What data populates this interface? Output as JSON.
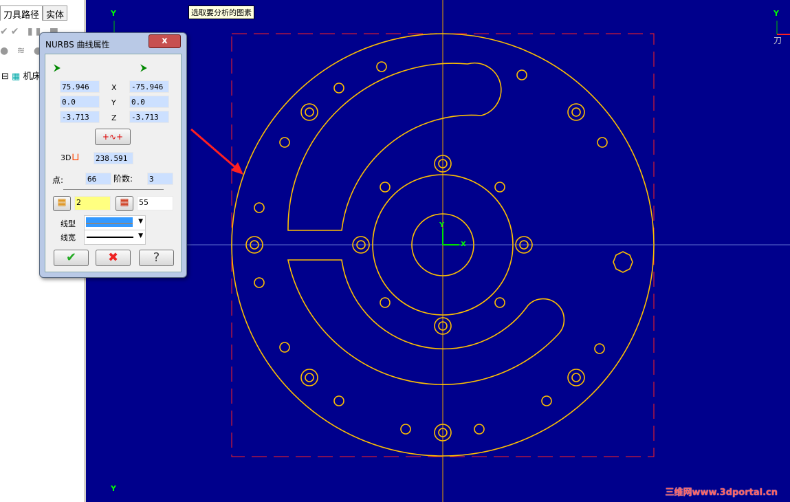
{
  "left_panel": {
    "tabs": [
      "刀具路径",
      "实体"
    ],
    "tree": [
      {
        "label": "机床"
      }
    ]
  },
  "hint": "选取要分析的图素",
  "axis": {
    "y_label": "Y",
    "x_label": "X",
    "tool_label": "刀"
  },
  "dialog": {
    "title": "NURBS 曲线属性",
    "close": "x",
    "start": {
      "x": "75.946",
      "y": "0.0",
      "z": "-3.713"
    },
    "end": {
      "x": "-75.946",
      "y": "0.0",
      "z": "-3.713"
    },
    "axis_labels": [
      "X",
      "Y",
      "Z"
    ],
    "length_label": "3D",
    "length": "238.591",
    "points_label": "点:",
    "points": "66",
    "degree_label": "阶数:",
    "degree": "3",
    "level": "2",
    "color": "55",
    "linetype_label": "线型",
    "linewidth_label": "线宽",
    "ok_icon": "check-icon",
    "cancel_icon": "x-icon",
    "help_icon": "question-icon"
  },
  "watermark": "三维网www.3dportal.cn",
  "colors": {
    "background": "#00008c",
    "geometry": "#ffc000",
    "boundary": "#ff2020",
    "crosshair": "#e8a000"
  }
}
